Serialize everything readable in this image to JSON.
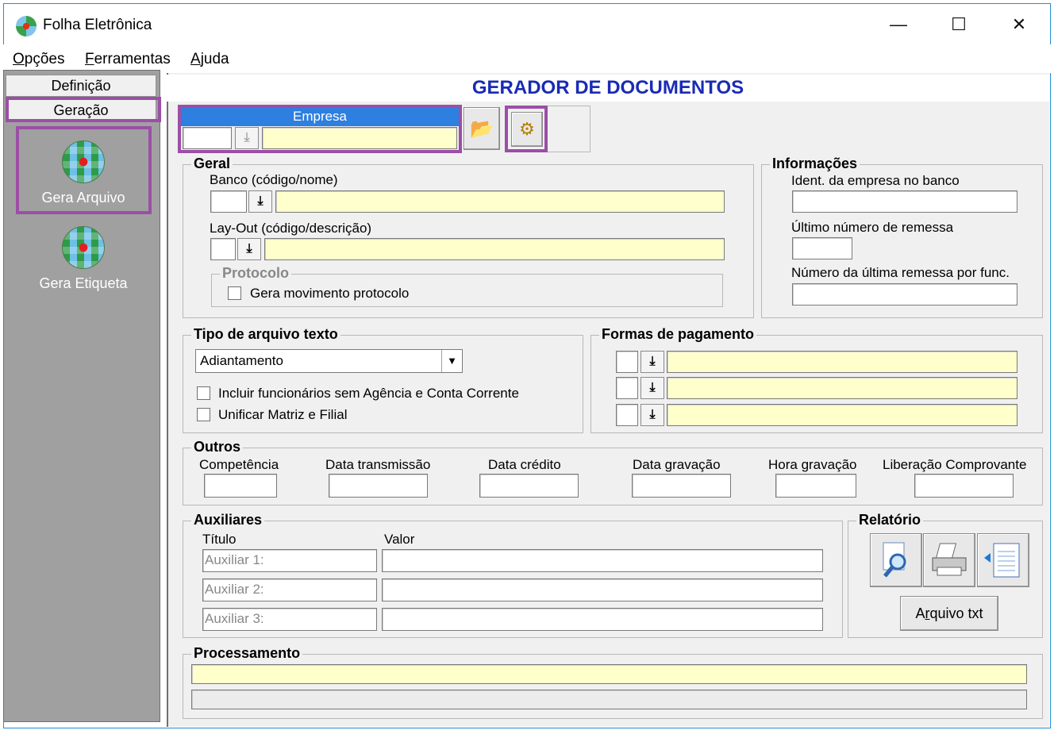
{
  "window": {
    "title": "Folha Eletrônica",
    "minimize": "—",
    "maximize": "☐",
    "close": "✕"
  },
  "menu": [
    {
      "first": "O",
      "rest": "pções"
    },
    {
      "first": "F",
      "rest": "erramentas"
    },
    {
      "first": "A",
      "rest": "juda"
    }
  ],
  "sidebar": {
    "tabs": [
      "Definição",
      "Geração"
    ],
    "items": [
      "Gera Arquivo",
      "Gera Etiqueta"
    ]
  },
  "main": {
    "title": "GERADOR DE DOCUMENTOS",
    "empresa": {
      "header": "Empresa",
      "code": "",
      "name": ""
    },
    "toolbar": {
      "open_icon": "📂",
      "process_icon": "⚙"
    }
  },
  "geral": {
    "title": "Geral",
    "banco_label": "Banco (código/nome)",
    "layout_label": "Lay-Out (código/descrição)",
    "protocolo": {
      "title": "Protocolo",
      "checkbox": "Gera movimento protocolo"
    }
  },
  "informacoes": {
    "title": "Informações",
    "ident_label": "Ident. da empresa no banco",
    "ultimo_label": "Último número de remessa",
    "numero_label": "Número da última remessa por func."
  },
  "tipo_arquivo": {
    "title": "Tipo de arquivo texto",
    "selected": "Adiantamento",
    "check1": "Incluir funcionários sem Agência e Conta Corrente",
    "check2": "Unificar Matriz e Filial"
  },
  "formas_pagamento": {
    "title": "Formas de pagamento"
  },
  "outros": {
    "title": "Outros",
    "labels": [
      "Competência",
      "Data transmissão",
      "Data crédito",
      "Data gravação",
      "Hora gravação",
      "Liberação Comprovante"
    ]
  },
  "auxiliares": {
    "title": "Auxiliares",
    "col_titulo": "Título",
    "col_valor": "Valor",
    "rows": [
      "Auxiliar  1:",
      "Auxiliar  2:",
      "Auxiliar  3:"
    ]
  },
  "relatorio": {
    "title": "Relatório",
    "txt_button_first": "A",
    "txt_button_u": "r",
    "txt_button_rest": "quivo txt"
  },
  "processamento": {
    "title": "Processamento"
  },
  "icons": {
    "download": "⤓",
    "dropdown": "▼"
  }
}
